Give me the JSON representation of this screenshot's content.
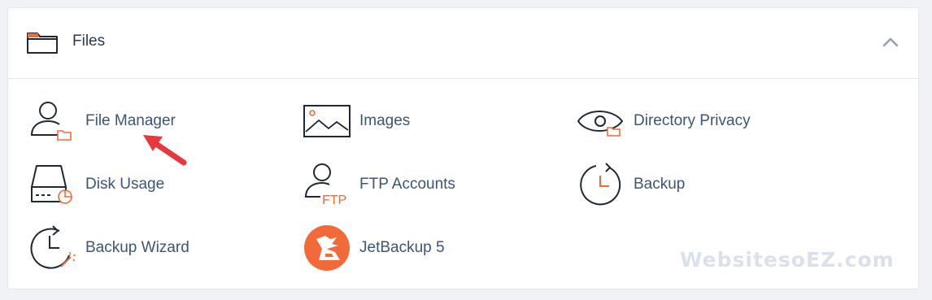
{
  "section": {
    "title": "Files",
    "header_icon": "folder-icon",
    "collapse_icon": "chevron-up-icon",
    "accent_color": "#f26a38",
    "text_color": "#3b5577"
  },
  "items": [
    {
      "label": "File Manager",
      "icon": "file-manager-icon"
    },
    {
      "label": "Images",
      "icon": "images-icon"
    },
    {
      "label": "Directory Privacy",
      "icon": "directory-privacy-icon"
    },
    {
      "label": "Disk Usage",
      "icon": "disk-usage-icon"
    },
    {
      "label": "FTP Accounts",
      "icon": "ftp-accounts-icon"
    },
    {
      "label": "Backup",
      "icon": "backup-icon"
    },
    {
      "label": "Backup Wizard",
      "icon": "backup-wizard-icon"
    },
    {
      "label": "JetBackup 5",
      "icon": "jetbackup-icon"
    }
  ],
  "ftp_icon_text": "FTP",
  "watermark": "WebsitesoEZ.com"
}
